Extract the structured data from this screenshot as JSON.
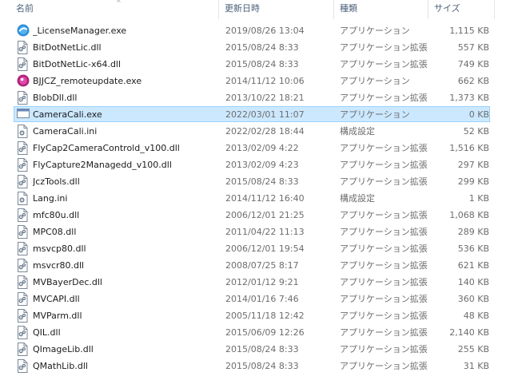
{
  "header": {
    "name": "名前",
    "date": "更新日時",
    "type": "種類",
    "size": "サイズ",
    "sort_indicator": "^"
  },
  "files": [
    {
      "name": "_LicenseManager.exe",
      "date": "2019/08/26 13:04",
      "type": "アプリケーション",
      "size": "1,115 KB",
      "icon": "blue-circle-app-icon"
    },
    {
      "name": "BitDotNetLic.dll",
      "date": "2015/08/24 8:33",
      "type": "アプリケーション拡張",
      "size": "557 KB",
      "icon": "dll-file-icon"
    },
    {
      "name": "BitDotNetLic-x64.dll",
      "date": "2015/08/24 8:33",
      "type": "アプリケーション拡張",
      "size": "749 KB",
      "icon": "dll-file-icon"
    },
    {
      "name": "BJJCZ_remoteupdate.exe",
      "date": "2014/11/12 10:06",
      "type": "アプリケーション",
      "size": "662 KB",
      "icon": "magenta-circle-app-icon"
    },
    {
      "name": "BlobDll.dll",
      "date": "2013/10/22 18:21",
      "type": "アプリケーション拡張",
      "size": "1,373 KB",
      "icon": "dll-file-icon"
    },
    {
      "name": "CameraCali.exe",
      "date": "2022/03/01 11:07",
      "type": "アプリケーション",
      "size": "0 KB",
      "icon": "window-app-icon",
      "selected": true
    },
    {
      "name": "CameraCali.ini",
      "date": "2022/02/28 18:44",
      "type": "構成設定",
      "size": "52 KB",
      "icon": "ini-settings-icon"
    },
    {
      "name": "FlyCap2CameraControld_v100.dll",
      "date": "2013/02/09 4:22",
      "type": "アプリケーション拡張",
      "size": "1,516 KB",
      "icon": "dll-file-icon"
    },
    {
      "name": "FlyCapture2Managedd_v100.dll",
      "date": "2013/02/09 4:23",
      "type": "アプリケーション拡張",
      "size": "297 KB",
      "icon": "dll-file-icon"
    },
    {
      "name": "JczTools.dll",
      "date": "2015/08/24 8:33",
      "type": "アプリケーション拡張",
      "size": "299 KB",
      "icon": "dll-file-icon"
    },
    {
      "name": "Lang.ini",
      "date": "2014/11/12 16:40",
      "type": "構成設定",
      "size": "1 KB",
      "icon": "ini-settings-icon"
    },
    {
      "name": "mfc80u.dll",
      "date": "2006/12/01 21:25",
      "type": "アプリケーション拡張",
      "size": "1,068 KB",
      "icon": "dll-file-icon"
    },
    {
      "name": "MPC08.dll",
      "date": "2011/04/22 11:13",
      "type": "アプリケーション拡張",
      "size": "289 KB",
      "icon": "dll-file-icon"
    },
    {
      "name": "msvcp80.dll",
      "date": "2006/12/01 19:54",
      "type": "アプリケーション拡張",
      "size": "536 KB",
      "icon": "dll-file-icon"
    },
    {
      "name": "msvcr80.dll",
      "date": "2008/07/25 8:17",
      "type": "アプリケーション拡張",
      "size": "621 KB",
      "icon": "dll-file-icon"
    },
    {
      "name": "MVBayerDec.dll",
      "date": "2012/01/12 9:21",
      "type": "アプリケーション拡張",
      "size": "140 KB",
      "icon": "dll-file-icon"
    },
    {
      "name": "MVCAPI.dll",
      "date": "2014/01/16 7:46",
      "type": "アプリケーション拡張",
      "size": "360 KB",
      "icon": "dll-file-icon"
    },
    {
      "name": "MVParm.dll",
      "date": "2005/11/18 12:42",
      "type": "アプリケーション拡張",
      "size": "48 KB",
      "icon": "dll-file-icon"
    },
    {
      "name": "QIL.dll",
      "date": "2015/06/09 12:26",
      "type": "アプリケーション拡張",
      "size": "2,140 KB",
      "icon": "dll-file-icon"
    },
    {
      "name": "QImageLib.dll",
      "date": "2015/08/24 8:33",
      "type": "アプリケーション拡張",
      "size": "255 KB",
      "icon": "dll-file-icon"
    },
    {
      "name": "QMathLib.dll",
      "date": "2015/08/24 8:33",
      "type": "アプリケーション拡張",
      "size": "31 KB",
      "icon": "dll-file-icon"
    }
  ],
  "colors": {
    "header_text": "#4c607a",
    "selection_fill": "#cce8ff",
    "selection_border": "#99d1ff",
    "secondary_text": "#6d6d6d"
  }
}
